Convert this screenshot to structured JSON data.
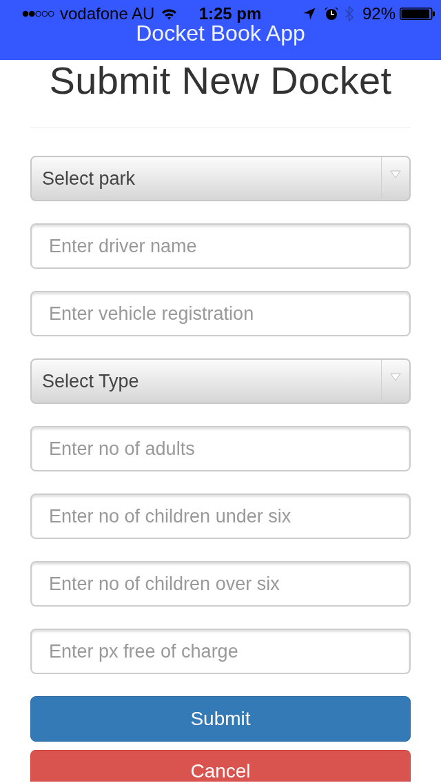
{
  "status_bar": {
    "carrier": "vodafone AU",
    "time": "1:25 pm",
    "battery": "92%"
  },
  "header": {
    "title": "Docket Book App"
  },
  "page": {
    "heading": "Submit New Docket"
  },
  "form": {
    "fields": [
      {
        "kind": "select",
        "value": "Select park"
      },
      {
        "kind": "input",
        "placeholder": "Enter driver name"
      },
      {
        "kind": "input",
        "placeholder": "Enter vehicle registration"
      },
      {
        "kind": "select",
        "value": "Select Type"
      },
      {
        "kind": "input",
        "placeholder": "Enter no of adults"
      },
      {
        "kind": "input",
        "placeholder": "Enter no of children under six"
      },
      {
        "kind": "input",
        "placeholder": "Enter no of children over six"
      },
      {
        "kind": "input",
        "placeholder": "Enter px free of charge"
      }
    ]
  },
  "buttons": [
    {
      "kind": "primary",
      "label": "Submit"
    },
    {
      "kind": "danger",
      "label": "Cancel"
    }
  ]
}
